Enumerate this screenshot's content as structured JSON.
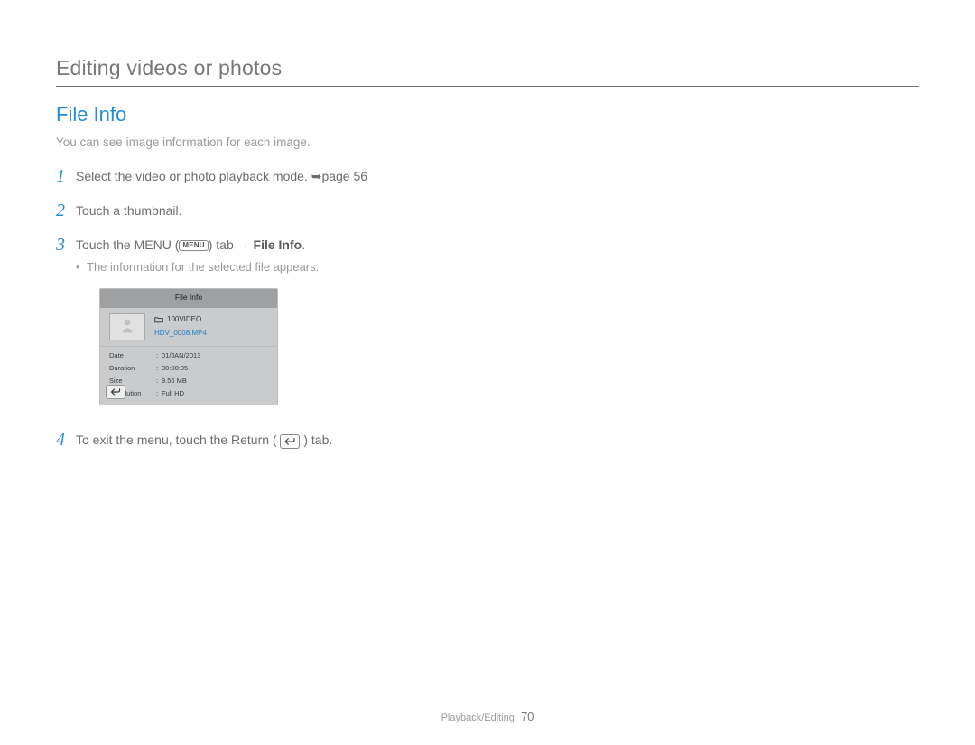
{
  "page": {
    "title": "Editing videos or photos",
    "section_title": "File Info",
    "intro": "You can see image information for each image.",
    "footer_section": "Playback/Editing",
    "footer_page": "70"
  },
  "steps": {
    "s1": {
      "num": "1",
      "text_a": "Select the video or photo playback mode. ",
      "arrow": "➥",
      "text_b": "page 56"
    },
    "s2": {
      "num": "2",
      "text": "Touch a thumbnail."
    },
    "s3": {
      "num": "3",
      "text_a": "Touch the MENU (",
      "menu_label": "MENU",
      "text_b": ") tab ",
      "arrow": "→",
      "text_c": " ",
      "bold": "File Info",
      "text_d": ".",
      "bullet": "The information for the selected file appears."
    },
    "s4": {
      "num": "4",
      "text_a": "To exit the menu, touch the Return (",
      "text_b": ") tab."
    }
  },
  "fileinfo": {
    "header": "File Info",
    "folder": "100VIDEO",
    "filename": "HDV_0008.MP4",
    "rows": {
      "date_label": "Date",
      "date_val": "01/JAN/2013",
      "duration_label": "Duration",
      "duration_val": "00:00:05",
      "size_label": "Size",
      "size_val": "9.56 MB",
      "res_label": "Resolution",
      "res_val": "Full HD"
    },
    "colon": ":"
  }
}
